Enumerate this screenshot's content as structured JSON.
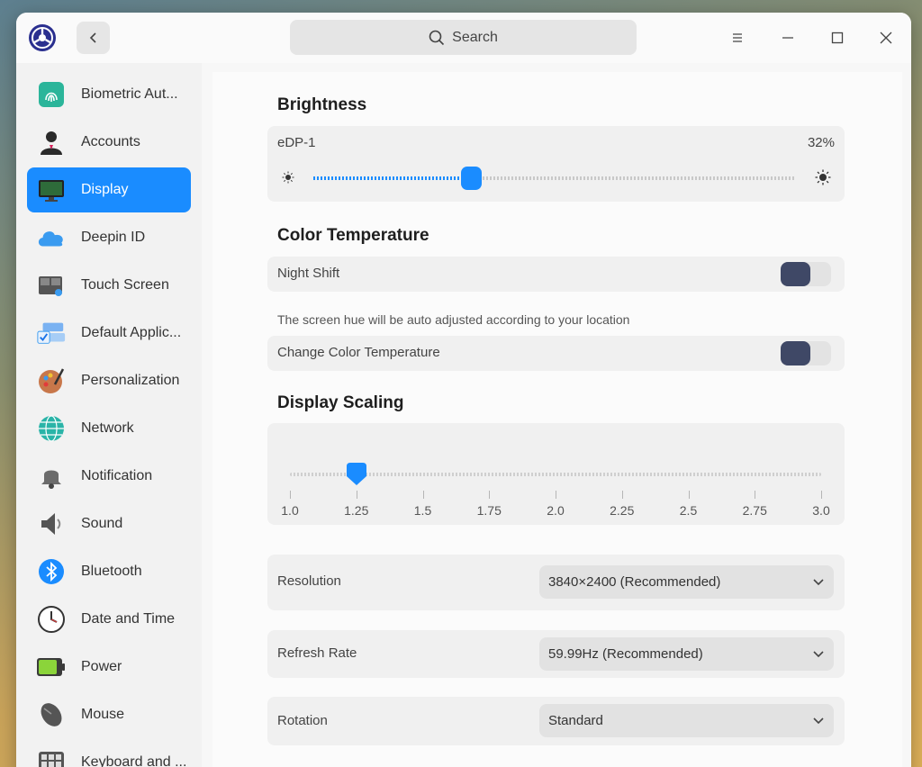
{
  "titlebar": {
    "search_placeholder": "Search"
  },
  "sidebar": {
    "items": [
      {
        "label": "Biometric Aut...",
        "icon": "fingerprint-icon"
      },
      {
        "label": "Accounts",
        "icon": "user-icon"
      },
      {
        "label": "Display",
        "icon": "monitor-icon",
        "active": true
      },
      {
        "label": "Deepin ID",
        "icon": "cloud-icon"
      },
      {
        "label": "Touch Screen",
        "icon": "touch-screen-icon"
      },
      {
        "label": "Default Applic...",
        "icon": "default-apps-icon"
      },
      {
        "label": "Personalization",
        "icon": "palette-icon"
      },
      {
        "label": "Network",
        "icon": "network-icon"
      },
      {
        "label": "Notification",
        "icon": "bell-icon"
      },
      {
        "label": "Sound",
        "icon": "speaker-icon"
      },
      {
        "label": "Bluetooth",
        "icon": "bluetooth-icon"
      },
      {
        "label": "Date and Time",
        "icon": "clock-icon"
      },
      {
        "label": "Power",
        "icon": "battery-icon"
      },
      {
        "label": "Mouse",
        "icon": "mouse-icon"
      },
      {
        "label": "Keyboard and ...",
        "icon": "keyboard-icon"
      }
    ]
  },
  "brightness": {
    "title": "Brightness",
    "monitor": "eDP-1",
    "value_text": "32%",
    "value": 0.32
  },
  "color_temperature": {
    "title": "Color Temperature",
    "night_shift_label": "Night Shift",
    "night_shift_hint": "The screen hue will be auto adjusted according to your location",
    "change_label": "Change Color Temperature"
  },
  "scaling": {
    "title": "Display Scaling",
    "ticks": [
      "1.0",
      "1.25",
      "1.5",
      "1.75",
      "2.0",
      "2.25",
      "2.5",
      "2.75",
      "3.0"
    ],
    "selected_index": 1
  },
  "resolution": {
    "label": "Resolution",
    "value": "3840×2400 (Recommended)"
  },
  "refresh_rate": {
    "label": "Refresh Rate",
    "value": "59.99Hz (Recommended)"
  },
  "rotation": {
    "label": "Rotation",
    "value": "Standard"
  },
  "colors": {
    "accent": "#1a8cff",
    "toggle_knob": "#3f4866"
  }
}
